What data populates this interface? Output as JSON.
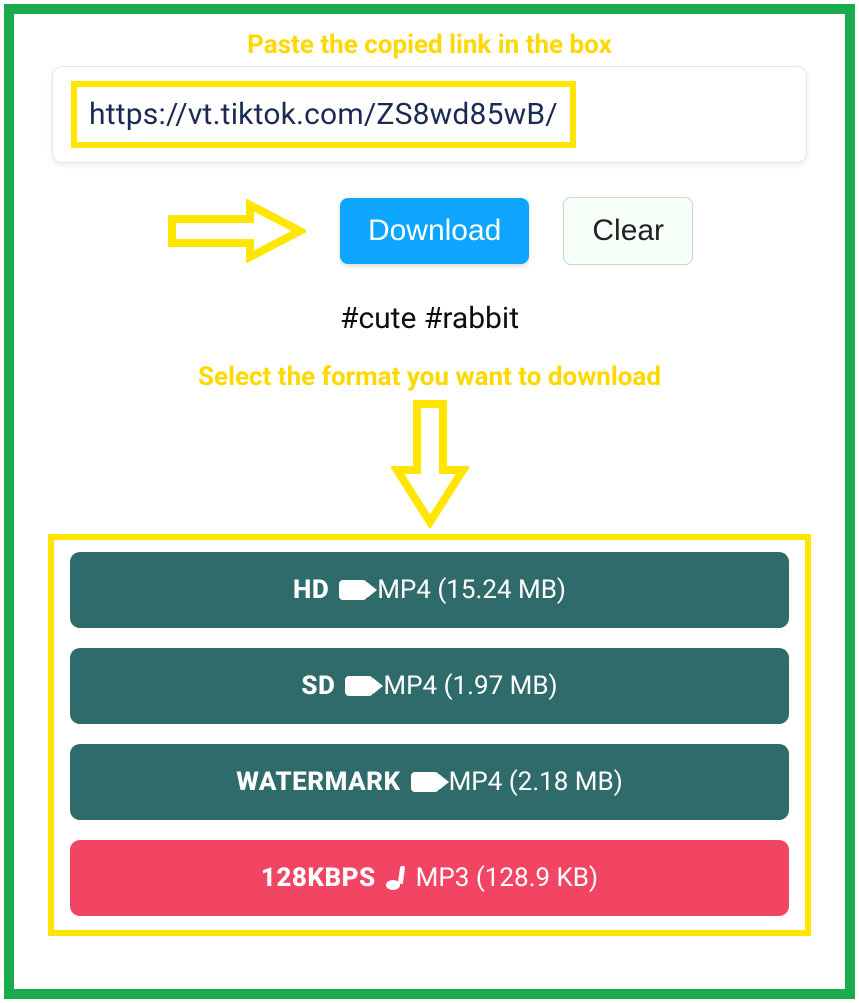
{
  "hint_top": "Paste the copied link in the box",
  "input": {
    "value": "https://vt.tiktok.com/ZS8wd85wB/"
  },
  "buttons": {
    "download": "Download",
    "clear": "Clear"
  },
  "hashtags": "#cute #rabbit",
  "hint_format": "Select the format you want to download",
  "colors": {
    "accent_yellow": "#ffe600",
    "btn_blue": "#0ea5ff",
    "opt_green": "#2f6b6b",
    "opt_red": "#f24564"
  },
  "options": [
    {
      "quality": "HD",
      "icon": "video",
      "format": "MP4",
      "size": "15.24 MB",
      "bg": "green"
    },
    {
      "quality": "SD",
      "icon": "video",
      "format": "MP4",
      "size": "1.97 MB",
      "bg": "green"
    },
    {
      "quality": "WATERMARK",
      "icon": "video",
      "format": "MP4",
      "size": "2.18 MB",
      "bg": "green"
    },
    {
      "quality": "128KBPS",
      "icon": "music",
      "format": "MP3",
      "size": "128.9 KB",
      "bg": "red"
    }
  ]
}
